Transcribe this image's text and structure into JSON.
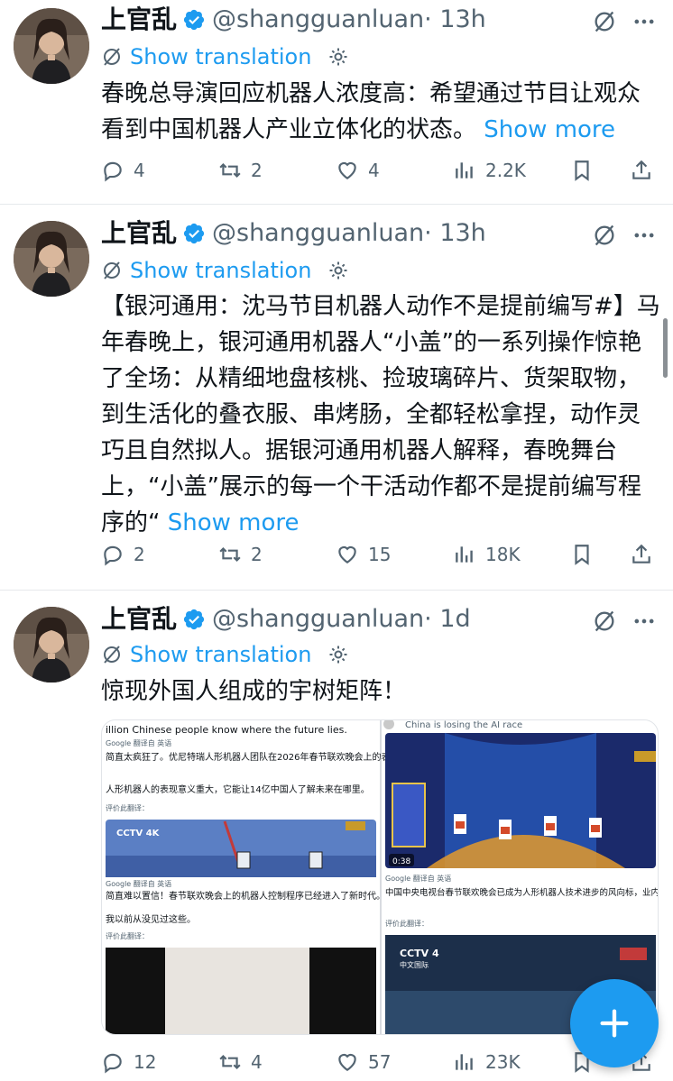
{
  "tweets": [
    {
      "name": "上官乱",
      "handle": "@shangguanluan",
      "time": "· 13h",
      "translate": "Show translation",
      "text": "春晚总导演回应机器人浓度高：希望通过节目让观众看到中国机器人产业立体化的状态。",
      "show_more": "Show more",
      "replies": "4",
      "retweets": "2",
      "likes": "4",
      "views": "2.2K"
    },
    {
      "name": "上官乱",
      "handle": "@shangguanluan",
      "time": "· 13h",
      "translate": "Show translation",
      "text": "【银河通用：沈马节目机器人动作不是提前编写#】马年春晚上，银河通用机器人“小盖”的一系列操作惊艳了全场：从精细地盘核桃、捡玻璃碎片、货架取物，到生活化的叠衣服、串烤肠，全都轻松拿捏，动作灵巧且自然拟人。据银河通用机器人解释，春晚舞台上，“小盖”展示的每一个干活动作都不是提前编写程序的“",
      "show_more": "Show more",
      "replies": "2",
      "retweets": "2",
      "likes": "15",
      "views": "18K"
    },
    {
      "name": "上官乱",
      "handle": "@shangguanluan",
      "time": "· 1d",
      "translate": "Show translation",
      "text": "惊现外国人组成的宇树矩阵！",
      "replies": "12",
      "retweets": "4",
      "likes": "57",
      "views": "23K",
      "media": {
        "left_top_en": "illion Chinese people know where the future lies.",
        "google_label": "Google 翻译自 英语",
        "left_t1": "简直太疯狂了。优尼特瑞人形机器人团队在2026年春节联欢晚会上的表演。",
        "left_t2": "人形机器人的表现意义重大，它能让14亿中国人了解未来在哪里。",
        "rate": "评价此翻译：",
        "left_t3": "简直难以置信！春节联欢晚会上的机器人控制程序已经进入了新时代。",
        "left_t4": "我以前从没见过这些。",
        "cctv4k": "CCTV 4K",
        "right_top_en": "China is losing the AI race",
        "time_badge": "0:38",
        "right_t1": "中国中央电视台春节联欢晚会已成为人形机器人技术进步的风向标，业内人士可以借此比较历年来的发展情况。",
        "cctv4": "CCTV 4",
        "cctv4_sub": "中文国际"
      }
    }
  ],
  "colors": {
    "accent": "#1d9bf0",
    "secondary": "#536471",
    "text": "#0f1419"
  }
}
